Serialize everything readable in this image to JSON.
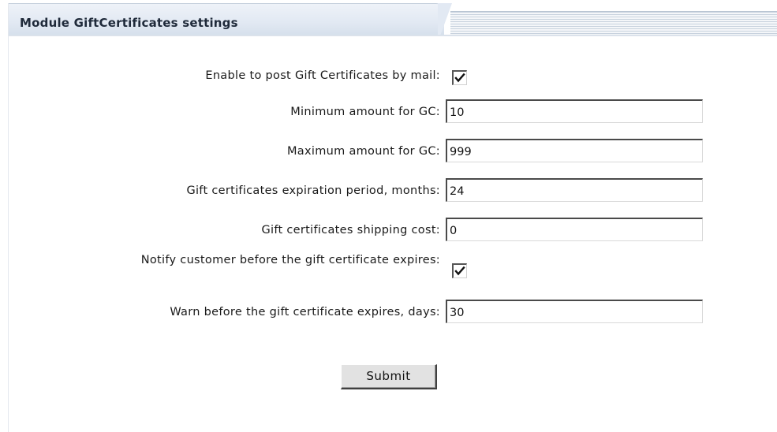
{
  "header": {
    "title": "Module GiftCertificates settings"
  },
  "form": {
    "post_by_mail": {
      "label": "Enable to post Gift Certificates by mail:",
      "checked": true
    },
    "min_amount": {
      "label": "Minimum amount for GC:",
      "value": "10"
    },
    "max_amount": {
      "label": "Maximum amount for GC:",
      "value": "999"
    },
    "expiration_period": {
      "label": "Gift certificates expiration period, months:",
      "value": "24"
    },
    "shipping_cost": {
      "label": "Gift certificates shipping cost:",
      "value": "0"
    },
    "notify_customer": {
      "label": "Notify customer before the gift certificate expires:",
      "checked": true
    },
    "warn_days": {
      "label": "Warn before the gift certificate expires, days:",
      "value": "30"
    },
    "submit_label": "Submit"
  },
  "colors": {
    "header_bg": "#e2e9f3",
    "header_text": "#1f2a3a",
    "button_bg": "#e2e2e2"
  }
}
